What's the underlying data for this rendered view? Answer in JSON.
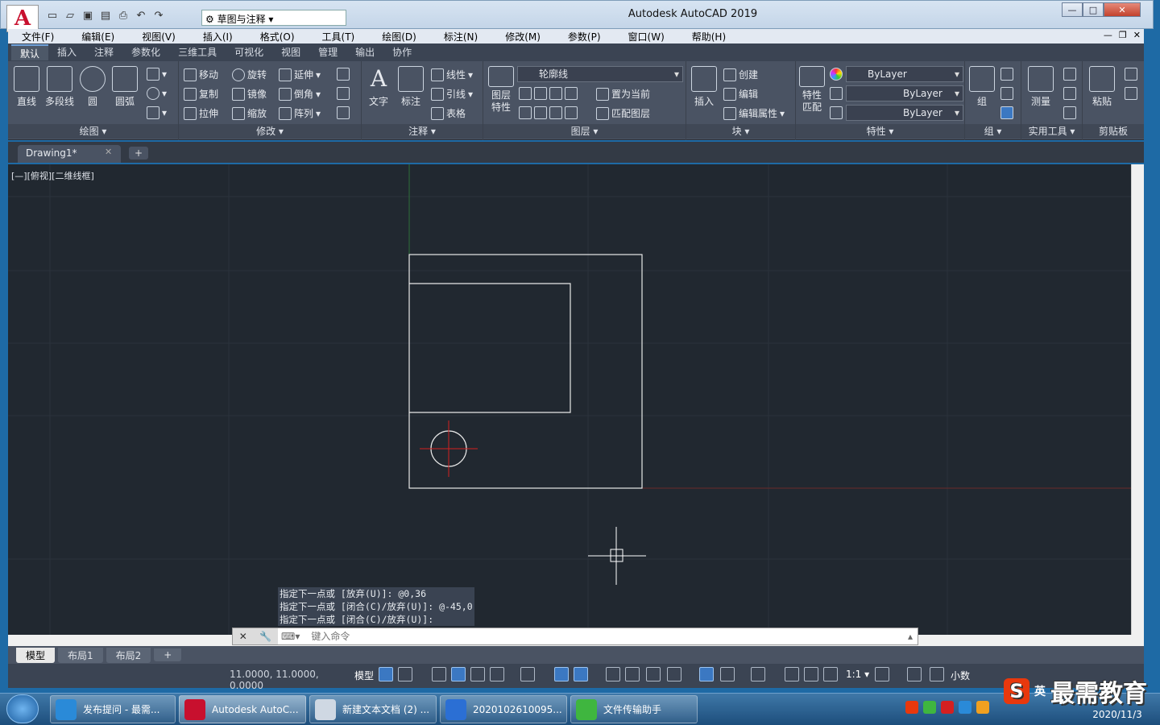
{
  "window": {
    "title": "Autodesk AutoCAD 2019",
    "workspace": "草图与注释",
    "min": "—",
    "max": "□",
    "close": "✕"
  },
  "menu": [
    "文件(F)",
    "编辑(E)",
    "视图(V)",
    "插入(I)",
    "格式(O)",
    "工具(T)",
    "绘图(D)",
    "标注(N)",
    "修改(M)",
    "参数(P)",
    "窗口(W)",
    "帮助(H)"
  ],
  "ribbon_tabs": [
    "默认",
    "插入",
    "注释",
    "参数化",
    "三维工具",
    "可视化",
    "视图",
    "管理",
    "输出",
    "协作"
  ],
  "panels": {
    "draw": {
      "title": "绘图 ▾",
      "line": "直线",
      "polyline": "多段线",
      "circle": "圆",
      "arc": "圆弧"
    },
    "modify": {
      "title": "修改 ▾",
      "move": "移动",
      "rotate": "旋转",
      "extend": "延伸",
      "copy": "复制",
      "mirror": "镜像",
      "fillet": "倒角",
      "stretch": "拉伸",
      "scale": "缩放",
      "array": "阵列"
    },
    "annotation": {
      "title": "注释 ▾",
      "text": "文字",
      "dim": "标注",
      "leader_line": "线性",
      "leader": "引线",
      "table": "表格"
    },
    "layers": {
      "title": "图层 ▾",
      "props": "图层\n特性",
      "current_layer": "轮廓线",
      "make_current": "置为当前",
      "match_layer": "匹配图层"
    },
    "block": {
      "title": "块 ▾",
      "insert": "插入",
      "create": "创建",
      "edit": "编辑",
      "edit_attr": "编辑属性"
    },
    "properties": {
      "title": "特性 ▾",
      "match": "特性\n匹配",
      "color": "ByLayer",
      "linetype": "ByLayer",
      "lineweight": "ByLayer"
    },
    "groups": {
      "title": "组 ▾",
      "group": "组"
    },
    "utilities": {
      "title": "实用工具 ▾",
      "measure": "测量"
    },
    "clipboard": {
      "title": "剪贴板",
      "paste": "粘贴"
    }
  },
  "doc_tab": "Drawing1*",
  "viewport_label": "[—][俯视][二维线框]",
  "command_history": [
    "指定下一点或 [放弃(U)]: @0,36",
    "指定下一点或 [闭合(C)/放弃(U)]: @-45,0",
    "指定下一点或 [闭合(C)/放弃(U)]:"
  ],
  "command_placeholder": "键入命令",
  "layout_tabs": [
    "模型",
    "布局1",
    "布局2",
    "+"
  ],
  "status": {
    "coords": "11.0000, 11.0000, 0.0000",
    "model": "模型",
    "scale": "1:1 ▾",
    "units": "小数"
  },
  "taskbar": [
    {
      "label": "发布提问 - 最需...",
      "color": "#2a8ad8"
    },
    {
      "label": "Autodesk AutoC...",
      "color": "#c8102e"
    },
    {
      "label": "新建文本文档 (2) ...",
      "color": "#cfd8e3"
    },
    {
      "label": "2020102610095...",
      "color": "#2b6fd4"
    },
    {
      "label": "文件传输助手",
      "color": "#3fb63f"
    }
  ],
  "clock": {
    "time": "",
    "date": "2020/11/3"
  },
  "watermark": "最需教育",
  "ime": "英"
}
